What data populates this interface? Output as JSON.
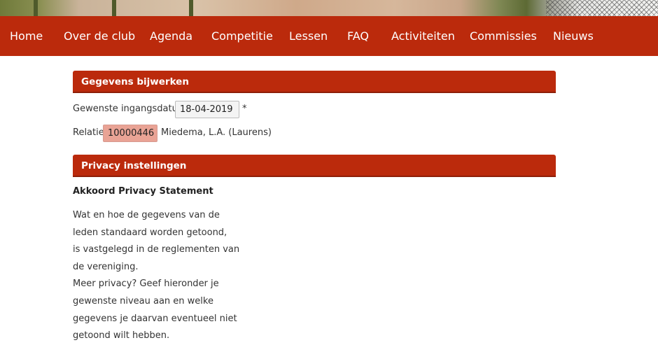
{
  "nav": {
    "items": [
      {
        "label": "Home"
      },
      {
        "label": "Over de club"
      },
      {
        "label": "Agenda"
      },
      {
        "label": "Competitie"
      },
      {
        "label": "Lessen"
      },
      {
        "label": "FAQ"
      },
      {
        "label": "Activiteiten"
      },
      {
        "label": "Commissies"
      },
      {
        "label": "Nieuws"
      }
    ]
  },
  "section_update": {
    "title": "Gegevens bijwerken",
    "date_label": "Gewenste ingangsdatum",
    "date_value": "18-04-2019",
    "required_mark": "*",
    "relation_label": "Relatie",
    "relation_value": "10000446",
    "relation_name": "Miedema, L.A. (Laurens)"
  },
  "section_privacy": {
    "title": "Privacy instellingen",
    "subheading": "Akkoord Privacy Statement",
    "lines": [
      "Wat en hoe de gegevens van de",
      "leden standaard worden getoond,",
      "is vastgelegd in de reglementen van",
      "de vereniging.",
      "Meer privacy? Geef hieronder je",
      "gewenste niveau aan en welke",
      "gegevens je daarvan eventueel niet",
      "getoond wilt hebben."
    ]
  },
  "colors": {
    "brand_red": "#bb2a0c",
    "highlight_input": "#e9a395"
  }
}
